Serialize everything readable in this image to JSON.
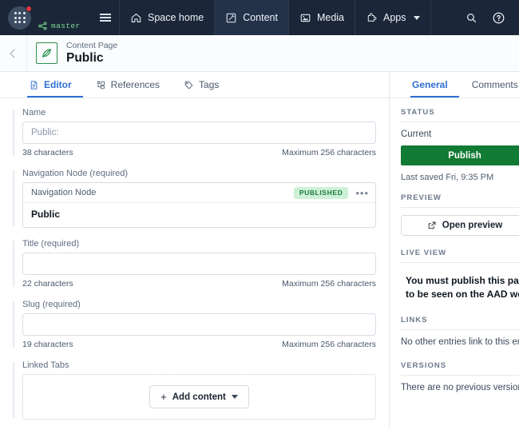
{
  "topnav": {
    "branch": "master",
    "app_launcher": "app-launcher",
    "items": [
      {
        "label": "Space home",
        "icon": "home-icon",
        "active": false
      },
      {
        "label": "Content",
        "icon": "content-icon",
        "active": true
      },
      {
        "label": "Media",
        "icon": "media-icon",
        "active": false
      },
      {
        "label": "Apps",
        "icon": "apps-icon",
        "active": false,
        "caret": true
      }
    ],
    "search_label": "Search",
    "help_label": "Help"
  },
  "page_header": {
    "back_label": "Back",
    "kicker": "Content Page",
    "title": "Public",
    "icon": "leaf-icon"
  },
  "editor_tabs": [
    {
      "label": "Editor",
      "icon": "document-icon",
      "active": true
    },
    {
      "label": "References",
      "icon": "references-icon",
      "active": false
    },
    {
      "label": "Tags",
      "icon": "tag-icon",
      "active": false
    }
  ],
  "form": {
    "name": {
      "label": "Name",
      "value": "Public:",
      "placeholder": "Public:",
      "count": "38 characters",
      "max": "Maximum 256 characters"
    },
    "navigation_node": {
      "label": "Navigation Node (required)",
      "card_type": "Navigation Node",
      "status_pill": "PUBLISHED",
      "more_label": "•••",
      "value": "Public"
    },
    "title": {
      "label": "Title (required)",
      "value": "",
      "placeholder": "",
      "count": "22 characters",
      "max": "Maximum 256 characters"
    },
    "slug": {
      "label": "Slug (required)",
      "value": "",
      "placeholder": "",
      "count": "19 characters",
      "max": "Maximum 256 characters"
    },
    "linked_tabs": {
      "label": "Linked Tabs",
      "add_button": "Add content",
      "plus": "+"
    }
  },
  "right_panel": {
    "tabs": [
      {
        "label": "General",
        "active": true
      },
      {
        "label": "Comments",
        "active": false
      }
    ],
    "status": {
      "heading": "STATUS",
      "current_label": "Current",
      "publish_button": "Publish",
      "last_saved": "Last saved Fri, 9:35 PM"
    },
    "preview": {
      "heading": "PREVIEW",
      "button": "Open preview",
      "icon": "external-link-icon"
    },
    "live_view": {
      "heading": "LIVE VIEW",
      "line1": "You must publish this page in order",
      "line2": "to be seen on the AAD website"
    },
    "links": {
      "heading": "LINKS",
      "text": "No other entries link to this entry."
    },
    "versions": {
      "heading": "VERSIONS",
      "text": "There are no previous versions because"
    }
  },
  "colors": {
    "nav_bg": "#1b2738",
    "accent_blue": "#2f6fd0",
    "publish_green": "#117a33",
    "pill_bg": "#cdf1d6",
    "pill_text": "#1c7a3c",
    "branch_green": "#7bd88f",
    "badge_red": "#e8333a"
  }
}
